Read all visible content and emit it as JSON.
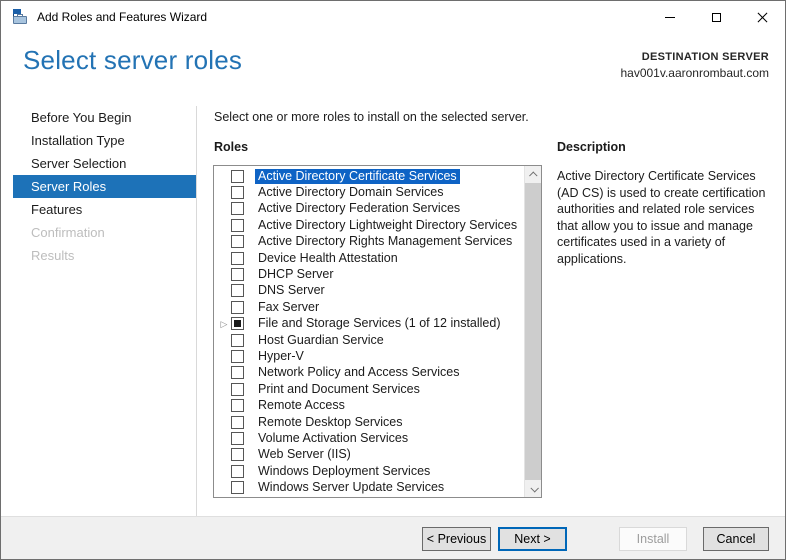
{
  "window": {
    "title": "Add Roles and Features Wizard"
  },
  "titlebar_controls": {
    "minimize": "minimize",
    "maximize": "maximize",
    "close": "close"
  },
  "header": {
    "title": "Select server roles",
    "destination_label": "DESTINATION SERVER",
    "destination_server": "hav001v.aaronrombaut.com"
  },
  "sidebar": {
    "items": [
      {
        "label": "Before You Begin",
        "state": "enabled"
      },
      {
        "label": "Installation Type",
        "state": "enabled"
      },
      {
        "label": "Server Selection",
        "state": "enabled"
      },
      {
        "label": "Server Roles",
        "state": "selected"
      },
      {
        "label": "Features",
        "state": "enabled"
      },
      {
        "label": "Confirmation",
        "state": "disabled"
      },
      {
        "label": "Results",
        "state": "disabled"
      }
    ]
  },
  "main": {
    "instruction": "Select one or more roles to install on the selected server.",
    "roles_label": "Roles",
    "roles": [
      {
        "label": "Active Directory Certificate Services",
        "checkbox": "unchecked",
        "selected": true,
        "expandable": false
      },
      {
        "label": "Active Directory Domain Services",
        "checkbox": "unchecked",
        "selected": false,
        "expandable": false
      },
      {
        "label": "Active Directory Federation Services",
        "checkbox": "unchecked",
        "selected": false,
        "expandable": false
      },
      {
        "label": "Active Directory Lightweight Directory Services",
        "checkbox": "unchecked",
        "selected": false,
        "expandable": false
      },
      {
        "label": "Active Directory Rights Management Services",
        "checkbox": "unchecked",
        "selected": false,
        "expandable": false
      },
      {
        "label": "Device Health Attestation",
        "checkbox": "unchecked",
        "selected": false,
        "expandable": false
      },
      {
        "label": "DHCP Server",
        "checkbox": "unchecked",
        "selected": false,
        "expandable": false
      },
      {
        "label": "DNS Server",
        "checkbox": "unchecked",
        "selected": false,
        "expandable": false
      },
      {
        "label": "Fax Server",
        "checkbox": "unchecked",
        "selected": false,
        "expandable": false
      },
      {
        "label": "File and Storage Services (1 of 12 installed)",
        "checkbox": "mixed",
        "selected": false,
        "expandable": true
      },
      {
        "label": "Host Guardian Service",
        "checkbox": "unchecked",
        "selected": false,
        "expandable": false
      },
      {
        "label": "Hyper-V",
        "checkbox": "unchecked",
        "selected": false,
        "expandable": false
      },
      {
        "label": "Network Policy and Access Services",
        "checkbox": "unchecked",
        "selected": false,
        "expandable": false
      },
      {
        "label": "Print and Document Services",
        "checkbox": "unchecked",
        "selected": false,
        "expandable": false
      },
      {
        "label": "Remote Access",
        "checkbox": "unchecked",
        "selected": false,
        "expandable": false
      },
      {
        "label": "Remote Desktop Services",
        "checkbox": "unchecked",
        "selected": false,
        "expandable": false
      },
      {
        "label": "Volume Activation Services",
        "checkbox": "unchecked",
        "selected": false,
        "expandable": false
      },
      {
        "label": "Web Server (IIS)",
        "checkbox": "unchecked",
        "selected": false,
        "expandable": false
      },
      {
        "label": "Windows Deployment Services",
        "checkbox": "unchecked",
        "selected": false,
        "expandable": false
      },
      {
        "label": "Windows Server Update Services",
        "checkbox": "unchecked",
        "selected": false,
        "expandable": false
      }
    ],
    "expand_glyph": "▷"
  },
  "description": {
    "title": "Description",
    "text": "Active Directory Certificate Services (AD CS) is used to create certification authorities and related role services that allow you to issue and manage certificates used in a variety of applications."
  },
  "footer": {
    "previous_label": "< Previous",
    "next_label": "Next >",
    "install_label": "Install",
    "cancel_label": "Cancel"
  },
  "colors": {
    "accent_blue": "#2373b4",
    "selection_blue": "#0e63c5",
    "nav_selected": "#1d72b8",
    "next_border": "#0067b8"
  }
}
